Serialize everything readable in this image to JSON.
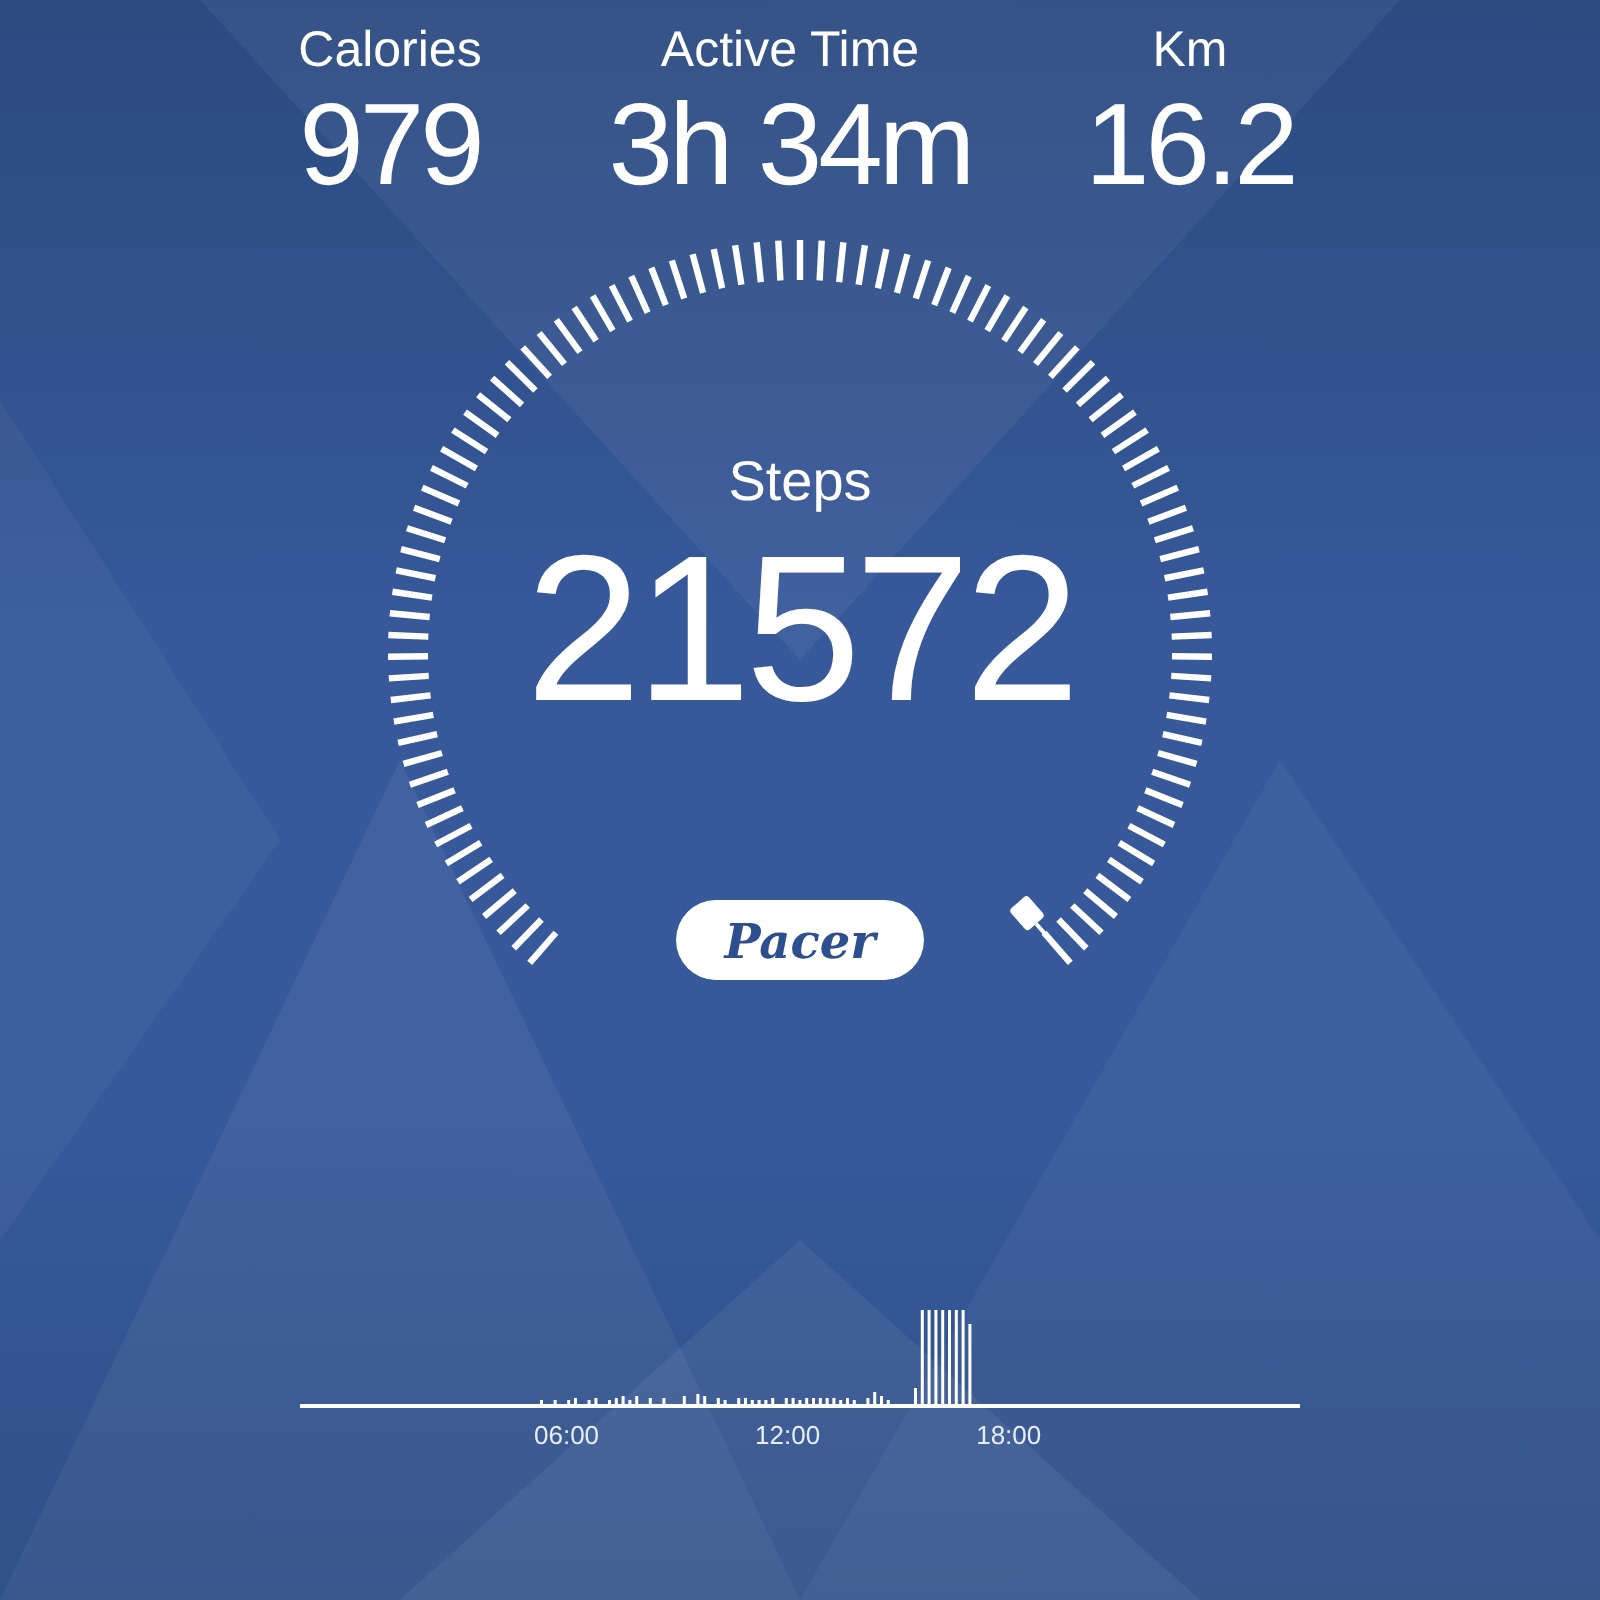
{
  "stats": [
    {
      "label": "Calories",
      "value": "979"
    },
    {
      "label": "Active Time",
      "value": "3h 34m"
    },
    {
      "label": "Km",
      "value": "16.2"
    }
  ],
  "gauge": {
    "label": "Steps",
    "value": "21572"
  },
  "logo": {
    "text": "Pacer"
  },
  "activity_chart": {
    "x_labels": [
      "06:00",
      "12:00",
      "18:00"
    ]
  }
}
